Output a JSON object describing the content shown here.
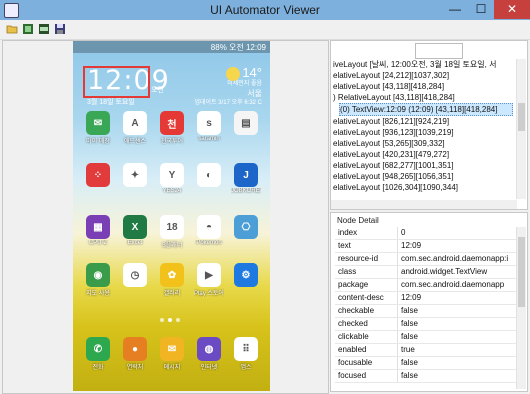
{
  "window": {
    "title": "UI Automator Viewer",
    "min": "—",
    "max": "☐",
    "close": "✕"
  },
  "toolbar": {
    "items": [
      "open-icon",
      "screenshot-icon",
      "compressed-screenshot-icon",
      "save-icon"
    ]
  },
  "phone": {
    "status_text": "88% 오전 12:09",
    "clock": "12:09",
    "ampm": "오전",
    "date": "3월 18일 토요일",
    "weather": {
      "temp": "14°",
      "line1": "미세먼지 좋음",
      "city": "서울",
      "updated": "업데이트 3/17 오후 6:32 C"
    },
    "apps": [
      {
        "label": "마이 매장",
        "color": "#3aa757",
        "glyph": "✉"
      },
      {
        "label": "애드센스",
        "color": "#ffffff",
        "glyph": "A"
      },
      {
        "label": "천국투어",
        "color": "#e53935",
        "glyph": "천"
      },
      {
        "label": "saramin",
        "color": "#ffffff",
        "glyph": "s"
      },
      {
        "label": "",
        "color": "#f5f5f5",
        "glyph": "▤"
      },
      {
        "label": "",
        "color": "#e23b3b",
        "glyph": "⁘"
      },
      {
        "label": "",
        "color": "#ffffff",
        "glyph": "✦"
      },
      {
        "label": "YES24",
        "color": "#ffffff",
        "glyph": "Y"
      },
      {
        "label": "",
        "color": "#ffffff",
        "glyph": "◐"
      },
      {
        "label": "JOBKOREA",
        "color": "#1d66c9",
        "glyph": "J"
      },
      {
        "label": "CPU-Z",
        "color": "#7b3fb5",
        "glyph": "▦"
      },
      {
        "label": "Excel",
        "color": "#1f7a43",
        "glyph": "X"
      },
      {
        "label": "S플래너",
        "color": "#ffffff",
        "glyph": "18"
      },
      {
        "label": "Pokemon",
        "color": "#ffffff",
        "glyph": "◓"
      },
      {
        "label": "",
        "color": "#4c9fd6",
        "glyph": "⎔"
      },
      {
        "label": "지도 사용",
        "color": "#3a9b4a",
        "glyph": "◉"
      },
      {
        "label": "",
        "color": "#ffffff",
        "glyph": "◷"
      },
      {
        "label": "갤러리",
        "color": "#f2c21a",
        "glyph": "✿"
      },
      {
        "label": "Play 스토어",
        "color": "#ffffff",
        "glyph": "▶"
      },
      {
        "label": "",
        "color": "#1e7ae0",
        "glyph": "⚙"
      },
      {
        "label": "전화",
        "color": "#2ea84f",
        "glyph": "✆"
      },
      {
        "label": "연락처",
        "color": "#e67e22",
        "glyph": "●"
      },
      {
        "label": "메시지",
        "color": "#f1b423",
        "glyph": "✉"
      },
      {
        "label": "인터넷",
        "color": "#6a4bc4",
        "glyph": "◍"
      },
      {
        "label": "앱스",
        "color": "#ffffff",
        "glyph": "⠿"
      }
    ]
  },
  "tree": {
    "rows": [
      "iveLayout [날씨, 12:00오전, 3월 18일 토요일, 서",
      "elativeLayout [24,212][1037,302]",
      "elativeLayout [43,118][418,284]",
      ") RelativeLayout [43,118][418,284]",
      "(0) TextView:12:09 (12:09) [43,118][418,284]",
      "elativeLayout [826,121][924,219]",
      "elativeLayout [936,123][1039,219]",
      "elativeLayout [53,265][309,332]",
      "elativeLayout [420,231][479,272]",
      "elativeLayout [682,277][1001,351]",
      "elativeLayout [948,265][1056,351]",
      "elativeLayout [1026,304][1090,344]"
    ],
    "selected_index": 4
  },
  "node_detail": {
    "title": "Node Detail",
    "props": [
      {
        "k": "index",
        "v": "0"
      },
      {
        "k": "text",
        "v": "12:09"
      },
      {
        "k": "resource-id",
        "v": "com.sec.android.daemonapp:i"
      },
      {
        "k": "class",
        "v": "android.widget.TextView"
      },
      {
        "k": "package",
        "v": "com.sec.android.daemonapp"
      },
      {
        "k": "content-desc",
        "v": "12:09"
      },
      {
        "k": "checkable",
        "v": "false"
      },
      {
        "k": "checked",
        "v": "false"
      },
      {
        "k": "clickable",
        "v": "false"
      },
      {
        "k": "enabled",
        "v": "true"
      },
      {
        "k": "focusable",
        "v": "false"
      },
      {
        "k": "focused",
        "v": "false"
      }
    ]
  }
}
